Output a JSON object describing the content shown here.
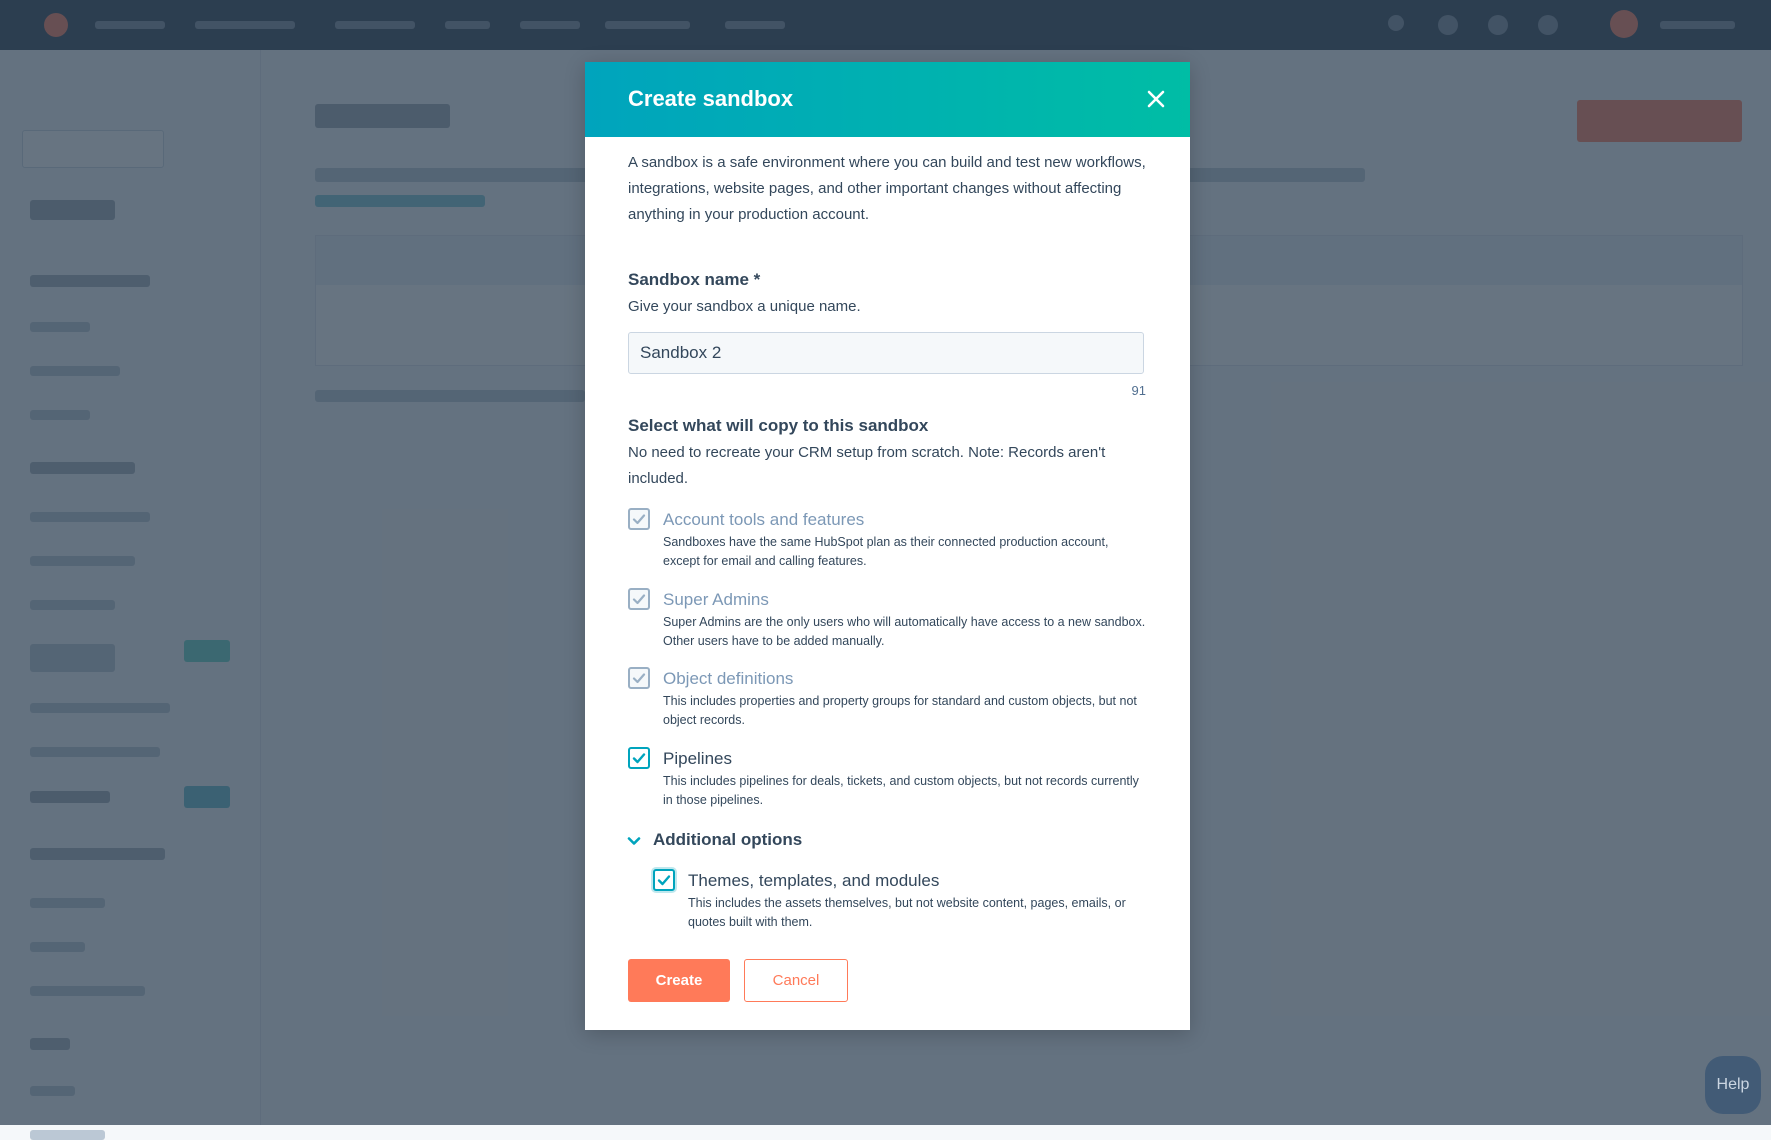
{
  "modal": {
    "title": "Create sandbox",
    "intro": "A sandbox is a safe environment where you can build and test new workflows, integrations, website pages, and other important changes without affecting anything in your production account.",
    "name_field": {
      "label": "Sandbox name *",
      "help": "Give your sandbox a unique name.",
      "value": "Sandbox 2",
      "char_count": "91"
    },
    "copy_section": {
      "title": "Select what will copy to this sandbox",
      "description": "No need to recreate your CRM setup from scratch. Note: Records aren't included."
    },
    "options": [
      {
        "label": "Account tools and features",
        "description": "Sandboxes have the same HubSpot plan as their connected production account, except for email and calling features.",
        "checked": true,
        "disabled": true
      },
      {
        "label": "Super Admins",
        "description": "Super Admins are the only users who will automatically have access to a new sandbox. Other users have to be added manually.",
        "checked": true,
        "disabled": true
      },
      {
        "label": "Object definitions",
        "description": "This includes properties and property groups for standard and custom objects, but not object records.",
        "checked": true,
        "disabled": true
      },
      {
        "label": "Pipelines",
        "description": "This includes pipelines for deals, tickets, and custom objects, but not records currently in those pipelines.",
        "checked": true,
        "disabled": false
      }
    ],
    "additional": {
      "label": "Additional options",
      "expanded": true,
      "options": [
        {
          "label": "Themes, templates, and modules",
          "description": "This includes the assets themselves, but not website content, pages, emails, or quotes built with them.",
          "checked": true,
          "disabled": false
        }
      ]
    },
    "buttons": {
      "create": "Create",
      "cancel": "Cancel"
    }
  },
  "help_button": "Help",
  "colors": {
    "accent": "#00a4bd",
    "header_gradient_end": "#00bda5",
    "primary_button": "#ff7a59",
    "overlay": "#2d3e50"
  },
  "icons": {
    "close": "close-icon",
    "checkbox": "checkmark-icon",
    "expand": "chevron-down-icon"
  }
}
